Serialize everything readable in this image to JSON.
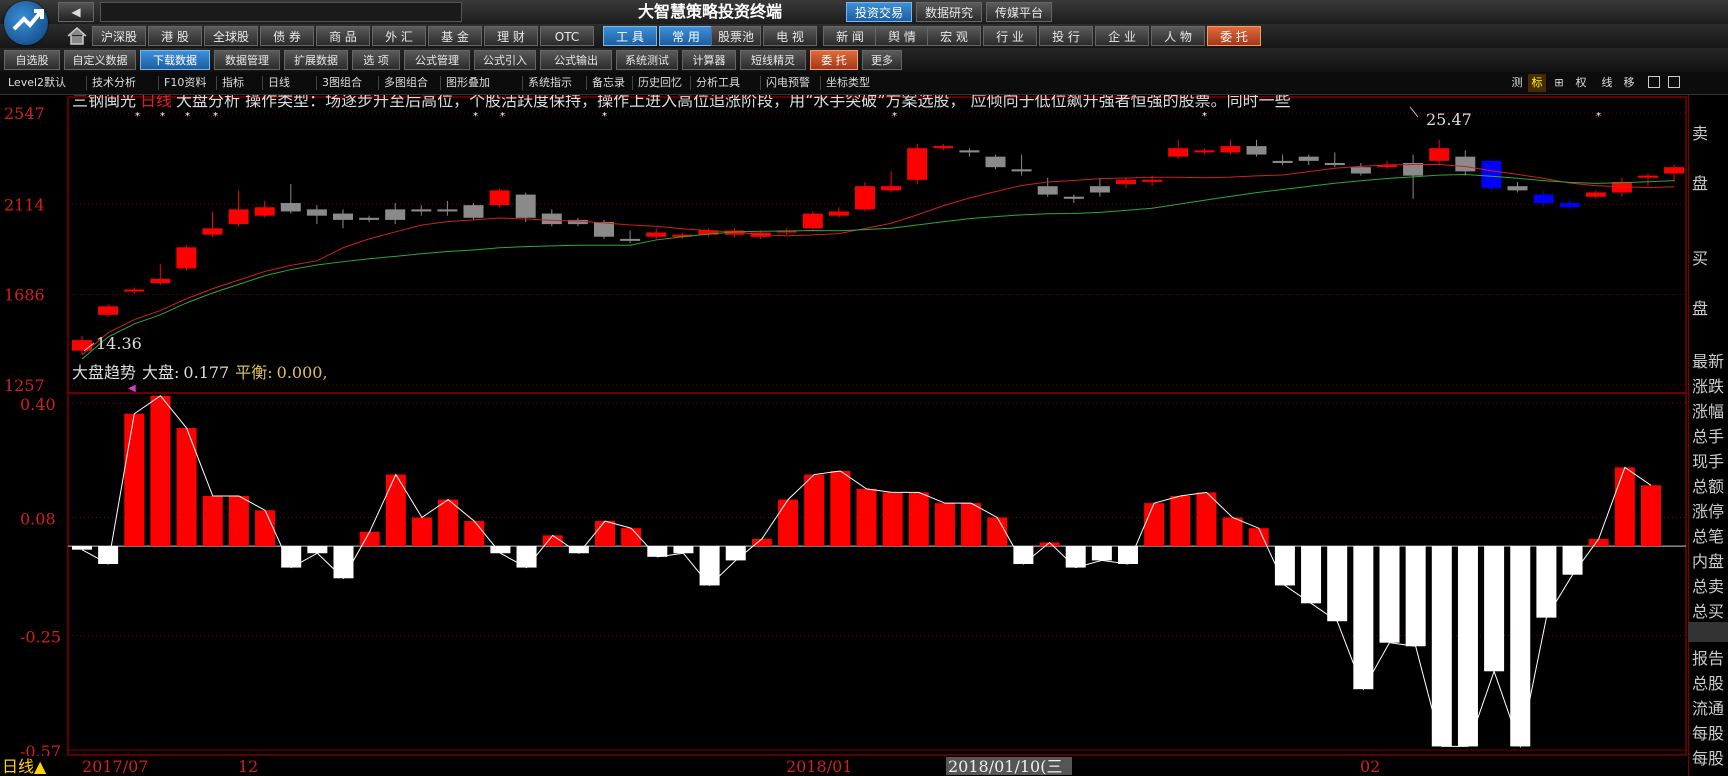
{
  "app": {
    "title": "大智慧策略投资终端",
    "nav_back": "◀",
    "nav_fwd": "▶"
  },
  "top_tabs": [
    "投资交易",
    "数据研究",
    "传媒平台"
  ],
  "market_tabs": [
    "沪深股",
    "港 股",
    "全球股",
    "债 券",
    "商 品",
    "外 汇",
    "基 金",
    "理 财",
    "OTC"
  ],
  "tool_tabs": [
    "工 具",
    "常 用",
    "股票池",
    "电 视",
    "新 闻",
    "舆 情",
    "宏 观",
    "行 业",
    "投 行",
    "企 业",
    "人 物",
    "委 托"
  ],
  "sub_tabs": [
    "自选股",
    "自定义数据",
    "下载数据",
    "数据管理",
    "扩展数据",
    "选 项",
    "公式管理",
    "公式引入",
    "公式输出",
    "系统测试",
    "计算器",
    "短线精灵",
    "委 托",
    "更多"
  ],
  "toolbar": [
    "Level2默认",
    "技术分析",
    "F10资料",
    "指标",
    "日线",
    "3图组合",
    "多图组合",
    "图形叠加",
    "系统指示",
    "备忘录",
    "历史回忆",
    "分析工具",
    "闪电预警",
    "坐标类型"
  ],
  "toolbar_right": [
    "测",
    "标",
    "⊞",
    "权",
    "线",
    "移"
  ],
  "stock": {
    "name": "三钢闽光",
    "period": "日线",
    "analysis_text": "大盘分析 操作类型：场逐步升至后高位，个股活跃度保持，操作上进入高位追涨阶段，用“水手突破”方案选股， 应倾向于低位飙升强者恒强的股票。同时一些",
    "high_label": "25.47",
    "low_label": "14.36"
  },
  "price_axis": [
    "2547",
    "2114",
    "1686",
    "1257"
  ],
  "indicator": {
    "name": "大盘趋势",
    "dapan_label": "大盘:",
    "dapan_value": "0.177",
    "pingheng_label": "平衡:",
    "pingheng_value": "0.000,"
  },
  "indicator_axis": [
    "0.40",
    "0.08",
    "-0.25",
    "-0.57"
  ],
  "date_axis": [
    "日线▲",
    "2017/07",
    "12",
    "2018/01",
    "2018/01/10(三",
    "02"
  ],
  "right_panel": {
    "top": [
      "卖",
      "盘",
      "买",
      "盘"
    ],
    "stats": [
      "最新",
      "涨跌",
      "涨幅",
      "总手",
      "现手",
      "总额",
      "涨停",
      "总笔",
      "内盘",
      "总卖",
      "总买"
    ],
    "bottom": [
      "报告",
      "总股",
      "流通",
      "每股",
      "每股"
    ]
  },
  "colors": {
    "up": "#ff0000",
    "down_gray": "#8a8a8a",
    "down_blue": "#0000ff",
    "ma_red": "#d02020",
    "ma_green": "#2fa82f",
    "grid": "#7a0000",
    "axis_text": "#d02020"
  },
  "chart_data": {
    "type": "candlestick",
    "title": "三钢闽光 日线",
    "ylim": [
      1257,
      2547
    ],
    "candles": [
      {
        "o": 1470,
        "c": 1420,
        "h": 1490,
        "l": 1400,
        "col": "up"
      },
      {
        "o": 1590,
        "c": 1630,
        "h": 1640,
        "l": 1580,
        "col": "up"
      },
      {
        "o": 1700,
        "c": 1710,
        "h": 1720,
        "l": 1690,
        "col": "up"
      },
      {
        "o": 1740,
        "c": 1760,
        "h": 1830,
        "l": 1730,
        "col": "up"
      },
      {
        "o": 1810,
        "c": 1910,
        "h": 1920,
        "l": 1800,
        "col": "up"
      },
      {
        "o": 2000,
        "c": 1970,
        "h": 2080,
        "l": 1960,
        "col": "up"
      },
      {
        "o": 2090,
        "c": 2020,
        "h": 2180,
        "l": 2010,
        "col": "up"
      },
      {
        "o": 2060,
        "c": 2100,
        "h": 2130,
        "l": 2050,
        "col": "up"
      },
      {
        "o": 2120,
        "c": 2080,
        "h": 2210,
        "l": 2070,
        "col": "gray"
      },
      {
        "o": 2090,
        "c": 2060,
        "h": 2110,
        "l": 2020,
        "col": "gray"
      },
      {
        "o": 2070,
        "c": 2040,
        "h": 2090,
        "l": 2000,
        "col": "gray"
      },
      {
        "o": 2040,
        "c": 2050,
        "h": 2060,
        "l": 2030,
        "col": "gray"
      },
      {
        "o": 2090,
        "c": 2040,
        "h": 2120,
        "l": 2020,
        "col": "gray"
      },
      {
        "o": 2090,
        "c": 2080,
        "h": 2110,
        "l": 2060,
        "col": "gray"
      },
      {
        "o": 2090,
        "c": 2080,
        "h": 2130,
        "l": 2060,
        "col": "gray"
      },
      {
        "o": 2110,
        "c": 2050,
        "h": 2120,
        "l": 2040,
        "col": "gray"
      },
      {
        "o": 2180,
        "c": 2110,
        "h": 2190,
        "l": 2100,
        "col": "up"
      },
      {
        "o": 2160,
        "c": 2050,
        "h": 2170,
        "l": 2030,
        "col": "gray"
      },
      {
        "o": 2070,
        "c": 2020,
        "h": 2090,
        "l": 2010,
        "col": "gray"
      },
      {
        "o": 2040,
        "c": 2020,
        "h": 2050,
        "l": 2010,
        "col": "gray"
      },
      {
        "o": 2030,
        "c": 1960,
        "h": 2040,
        "l": 1950,
        "col": "gray"
      },
      {
        "o": 1950,
        "c": 1950,
        "h": 1990,
        "l": 1930,
        "col": "gray"
      },
      {
        "o": 1960,
        "c": 1980,
        "h": 2000,
        "l": 1950,
        "col": "up"
      },
      {
        "o": 1970,
        "c": 1960,
        "h": 1980,
        "l": 1950,
        "col": "up"
      },
      {
        "o": 1970,
        "c": 1990,
        "h": 2000,
        "l": 1960,
        "col": "up"
      },
      {
        "o": 1970,
        "c": 1990,
        "h": 2000,
        "l": 1960,
        "col": "up"
      },
      {
        "o": 1960,
        "c": 1980,
        "h": 1990,
        "l": 1950,
        "col": "up"
      },
      {
        "o": 1980,
        "c": 1990,
        "h": 2000,
        "l": 1970,
        "col": "up"
      },
      {
        "o": 2000,
        "c": 2070,
        "h": 2080,
        "l": 1990,
        "col": "up"
      },
      {
        "o": 2060,
        "c": 2080,
        "h": 2100,
        "l": 2050,
        "col": "up"
      },
      {
        "o": 2090,
        "c": 2200,
        "h": 2220,
        "l": 2080,
        "col": "up"
      },
      {
        "o": 2180,
        "c": 2200,
        "h": 2270,
        "l": 2170,
        "col": "up"
      },
      {
        "o": 2230,
        "c": 2380,
        "h": 2400,
        "l": 2210,
        "col": "up"
      },
      {
        "o": 2380,
        "c": 2390,
        "h": 2400,
        "l": 2370,
        "col": "up"
      },
      {
        "o": 2370,
        "c": 2360,
        "h": 2380,
        "l": 2340,
        "col": "gray"
      },
      {
        "o": 2340,
        "c": 2290,
        "h": 2350,
        "l": 2280,
        "col": "gray"
      },
      {
        "o": 2280,
        "c": 2270,
        "h": 2350,
        "l": 2250,
        "col": "gray"
      },
      {
        "o": 2200,
        "c": 2160,
        "h": 2240,
        "l": 2150,
        "col": "gray"
      },
      {
        "o": 2150,
        "c": 2140,
        "h": 2160,
        "l": 2120,
        "col": "gray"
      },
      {
        "o": 2200,
        "c": 2170,
        "h": 2240,
        "l": 2150,
        "col": "gray"
      },
      {
        "o": 2210,
        "c": 2230,
        "h": 2240,
        "l": 2190,
        "col": "up"
      },
      {
        "o": 2230,
        "c": 2230,
        "h": 2250,
        "l": 2200,
        "col": "up"
      },
      {
        "o": 2340,
        "c": 2380,
        "h": 2420,
        "l": 2330,
        "col": "up"
      },
      {
        "o": 2360,
        "c": 2370,
        "h": 2380,
        "l": 2350,
        "col": "up"
      },
      {
        "o": 2360,
        "c": 2390,
        "h": 2420,
        "l": 2350,
        "col": "up"
      },
      {
        "o": 2390,
        "c": 2350,
        "h": 2420,
        "l": 2340,
        "col": "gray"
      },
      {
        "o": 2320,
        "c": 2310,
        "h": 2350,
        "l": 2300,
        "col": "gray"
      },
      {
        "o": 2340,
        "c": 2320,
        "h": 2350,
        "l": 2300,
        "col": "gray"
      },
      {
        "o": 2310,
        "c": 2300,
        "h": 2360,
        "l": 2290,
        "col": "gray"
      },
      {
        "o": 2290,
        "c": 2260,
        "h": 2310,
        "l": 2250,
        "col": "gray"
      },
      {
        "o": 2290,
        "c": 2300,
        "h": 2320,
        "l": 2280,
        "col": "up"
      },
      {
        "o": 2310,
        "c": 2250,
        "h": 2350,
        "l": 2140,
        "col": "gray"
      },
      {
        "o": 2320,
        "c": 2380,
        "h": 2420,
        "l": 2300,
        "col": "up"
      },
      {
        "o": 2340,
        "c": 2270,
        "h": 2370,
        "l": 2250,
        "col": "gray"
      },
      {
        "o": 2320,
        "c": 2190,
        "h": 2330,
        "l": 2180,
        "col": "blue"
      },
      {
        "o": 2200,
        "c": 2180,
        "h": 2220,
        "l": 2170,
        "col": "gray"
      },
      {
        "o": 2160,
        "c": 2120,
        "h": 2180,
        "l": 2100,
        "col": "blue"
      },
      {
        "o": 2120,
        "c": 2100,
        "h": 2140,
        "l": 2090,
        "col": "blue"
      },
      {
        "o": 2150,
        "c": 2170,
        "h": 2180,
        "l": 2140,
        "col": "up"
      },
      {
        "o": 2170,
        "c": 2220,
        "h": 2240,
        "l": 2150,
        "col": "up"
      },
      {
        "o": 2240,
        "c": 2250,
        "h": 2260,
        "l": 2200,
        "col": "up"
      },
      {
        "o": 2260,
        "c": 2290,
        "h": 2300,
        "l": 2220,
        "col": "up"
      }
    ],
    "indicator": {
      "ylim": [
        -0.57,
        0.4
      ],
      "values": [
        -0.01,
        -0.05,
        0.37,
        0.42,
        0.33,
        0.14,
        0.14,
        0.1,
        -0.06,
        -0.02,
        -0.09,
        0.04,
        0.2,
        0.08,
        0.13,
        0.07,
        -0.02,
        -0.06,
        0.03,
        -0.02,
        0.07,
        0.05,
        -0.03,
        -0.02,
        -0.11,
        -0.04,
        0.02,
        0.13,
        0.2,
        0.21,
        0.16,
        0.15,
        0.15,
        0.12,
        0.12,
        0.08,
        -0.05,
        0.01,
        -0.06,
        -0.04,
        -0.05,
        0.12,
        0.14,
        0.15,
        0.08,
        0.05,
        -0.11,
        -0.16,
        -0.21,
        -0.4,
        -0.27,
        -0.28,
        -0.56,
        -0.56,
        -0.35,
        -0.56,
        -0.2,
        -0.08,
        0.02,
        0.22,
        0.17
      ]
    }
  }
}
